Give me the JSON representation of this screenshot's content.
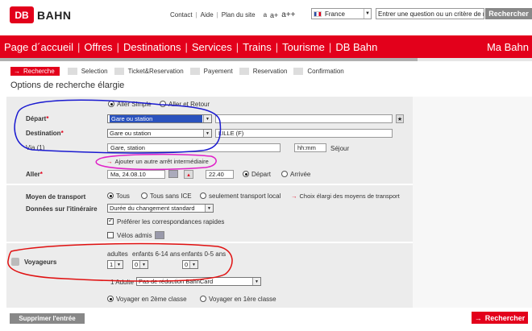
{
  "header": {
    "brand_mark": "DB",
    "brand_name": "BAHN",
    "links": [
      "Contact",
      "Aide",
      "Plan du site"
    ],
    "font_small": "a",
    "font_medium": "a+",
    "font_large": "a++",
    "language": "France",
    "search_placeholder": "Entrer une question ou un critère de re",
    "search_button": "Rechercher"
  },
  "nav": {
    "items": [
      "Page d´accueil",
      "Offres",
      "Destinations",
      "Services",
      "Trains",
      "Tourisme",
      "DB Bahn"
    ],
    "right_item": "Ma Bahn"
  },
  "steps": {
    "items": [
      "Recherche",
      "Selection",
      "Ticket&Reservation",
      "Payement",
      "Reservation",
      "Confirmation"
    ]
  },
  "page_title": "Options de recherche élargie",
  "trip": {
    "type_simple": "Aller Simple",
    "type_return": "Aller et Retour",
    "depart_label": "Départ",
    "depart_select": "Gare ou station",
    "destination_label": "Destination",
    "destination_select": "Gare ou station",
    "destination_value": "LILLE (F)",
    "via_label": "Via (1)",
    "via_value": "Gare, station",
    "via_time": "hh:mm",
    "via_stay": "Séjour",
    "add_stop": "Ajouter un autre arrêt intermédiaire",
    "aller_label": "Aller",
    "date_value": "Ma, 24.08.10",
    "time_value": "22.40",
    "opt_depart": "Départ",
    "opt_arrivee": "Arrivée",
    "required_mark": "*"
  },
  "transport": {
    "label": "Moyen de transport",
    "opt_all": "Tous",
    "opt_no_ice": "Tous sans ICE",
    "opt_local": "seulement transport local",
    "more_link": "Choix élargi des moyens de transport",
    "itinerary_label": "Données sur l'itinéraire",
    "itinerary_select": "Durée du changement standard",
    "fast_connections": "Préférer les correspondances rapides",
    "bikes": "Vélos admis"
  },
  "travellers": {
    "label": "Voyageurs",
    "adults_label": "adultes",
    "children_6_14_label": "enfants 6-14 ans",
    "children_0_5_label": "enfants 0-5 ans",
    "adults_value": "1",
    "children_6_14_value": "0",
    "children_0_5_value": "0",
    "adult_card_label": "1 Adulte",
    "card_select": "Pas de réduction BahnCard",
    "class_2": "Voyager en 2ème classe",
    "class_1": "Voyager en 1ère classe"
  },
  "actions": {
    "clear": "Supprimer l'entrée",
    "search": "Rechercher"
  },
  "colors": {
    "brand_red": "#e3001b",
    "annotation_blue": "#1a1ad0",
    "annotation_magenta": "#e020c8",
    "annotation_red": "#e01010"
  }
}
